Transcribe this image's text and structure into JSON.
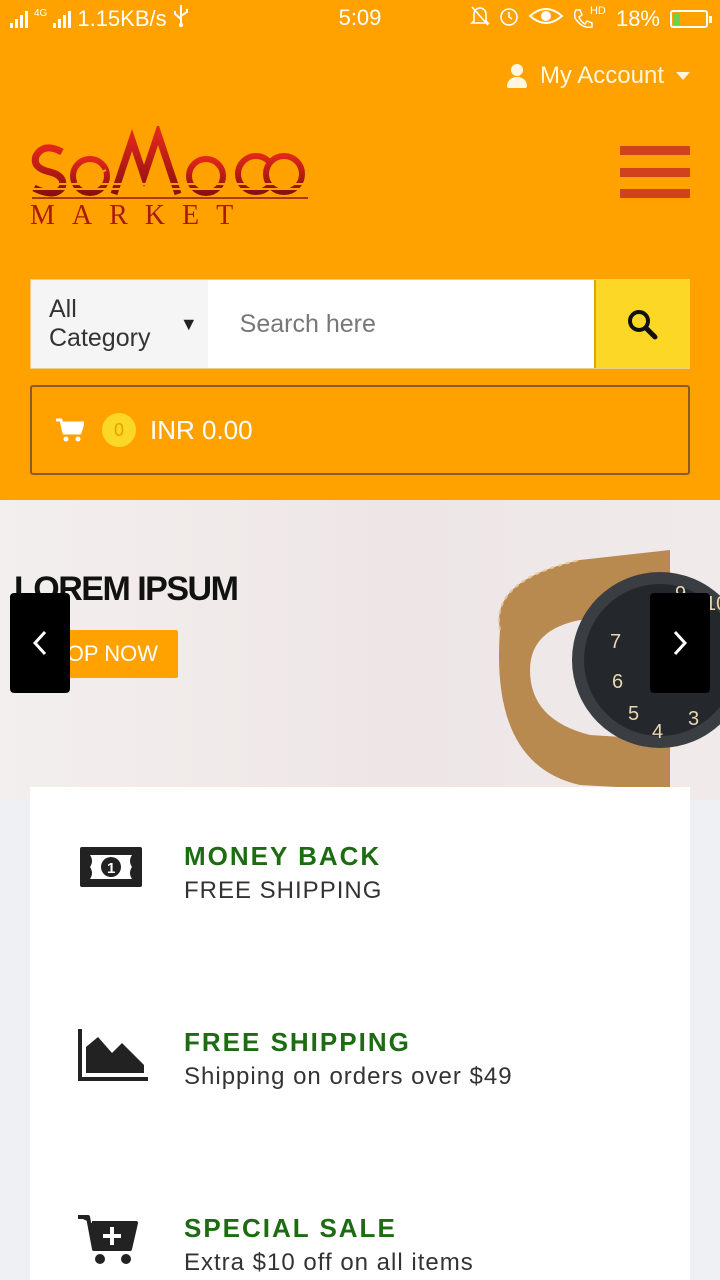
{
  "status_bar": {
    "network": "4G",
    "speed": "1.15KB/s",
    "time": "5:09",
    "hd": "HD",
    "battery": "18%"
  },
  "header": {
    "account_label": "My Account",
    "logo_top": "SoMoo",
    "logo_bottom": "MARKET"
  },
  "search": {
    "category": "All Category",
    "placeholder": "Search here"
  },
  "cart": {
    "count": "0",
    "total": "INR 0.00"
  },
  "banner": {
    "title": "LOREM IPSUM",
    "button": "OP NOW"
  },
  "features": [
    {
      "title": "MONEY BACK",
      "desc": "FREE SHIPPING",
      "icon": "money-bill-icon"
    },
    {
      "title": "FREE SHIPPING",
      "desc": "Shipping on orders over $49",
      "icon": "area-chart-icon"
    },
    {
      "title": "SPECIAL SALE",
      "desc": "Extra $10 off on all items",
      "icon": "cart-plus-icon"
    }
  ],
  "colors": {
    "header": "#ffa200",
    "search_button": "#fcd726",
    "menu_bars": "#d0421b",
    "feature_title": "#1d6b12"
  }
}
